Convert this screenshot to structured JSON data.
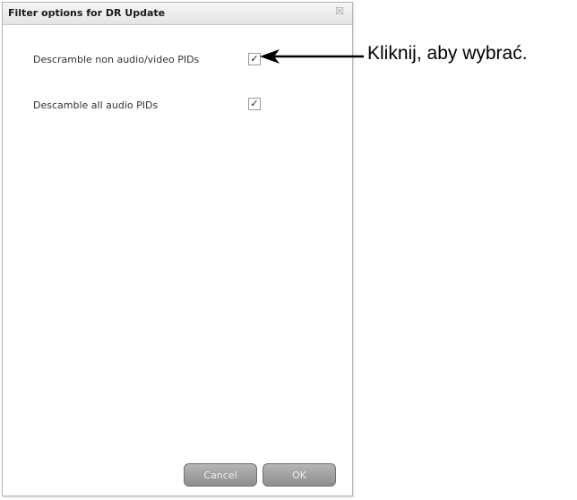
{
  "dialog": {
    "title": "Filter options for DR Update",
    "close_icon": "close-icon",
    "options": [
      {
        "label": "Descramble non audio/video PIDs",
        "checked": true
      },
      {
        "label": "Descamble all audio PIDs",
        "checked": true
      }
    ],
    "cancel_label": "Cancel",
    "ok_label": "OK"
  },
  "annotation": {
    "text": "Kliknij, aby wybrać."
  },
  "colors": {
    "button": "#9c9c9c",
    "annotation_text": "#000000"
  }
}
